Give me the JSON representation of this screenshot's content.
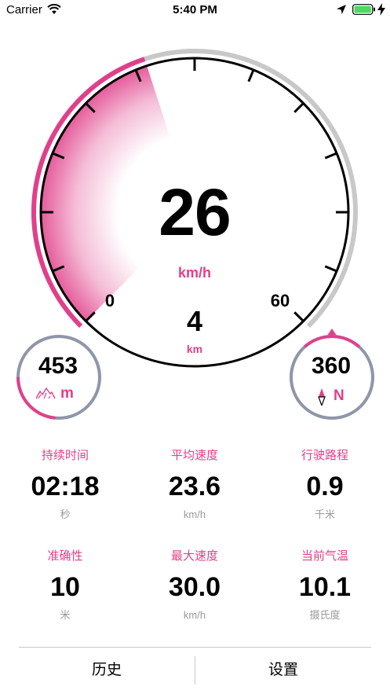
{
  "status_bar": {
    "carrier": "Carrier",
    "time": "5:40 PM"
  },
  "gauge": {
    "speed": "26",
    "speed_unit": "km/h",
    "scale_min": "0",
    "scale_max": "60",
    "speed_fraction": 0.433,
    "distance": "4",
    "distance_unit": "km",
    "accent_color": "#e0408a",
    "track_color": "#c8c8c8"
  },
  "altitude": {
    "value": "453",
    "unit": "m",
    "icon": "mountain-icon"
  },
  "heading": {
    "value": "360",
    "direction": "N",
    "icon": "compass-icon"
  },
  "stats": [
    {
      "label": "持续时间",
      "value": "02:18",
      "unit": "秒"
    },
    {
      "label": "平均速度",
      "value": "23.6",
      "unit": "km/h"
    },
    {
      "label": "行驶路程",
      "value": "0.9",
      "unit": "千米"
    },
    {
      "label": "准确性",
      "value": "10",
      "unit": "米"
    },
    {
      "label": "最大速度",
      "value": "30.0",
      "unit": "km/h"
    },
    {
      "label": "当前气温",
      "value": "10.1",
      "unit": "摄氏度"
    }
  ],
  "tabs": {
    "history": "历史",
    "settings": "设置"
  }
}
